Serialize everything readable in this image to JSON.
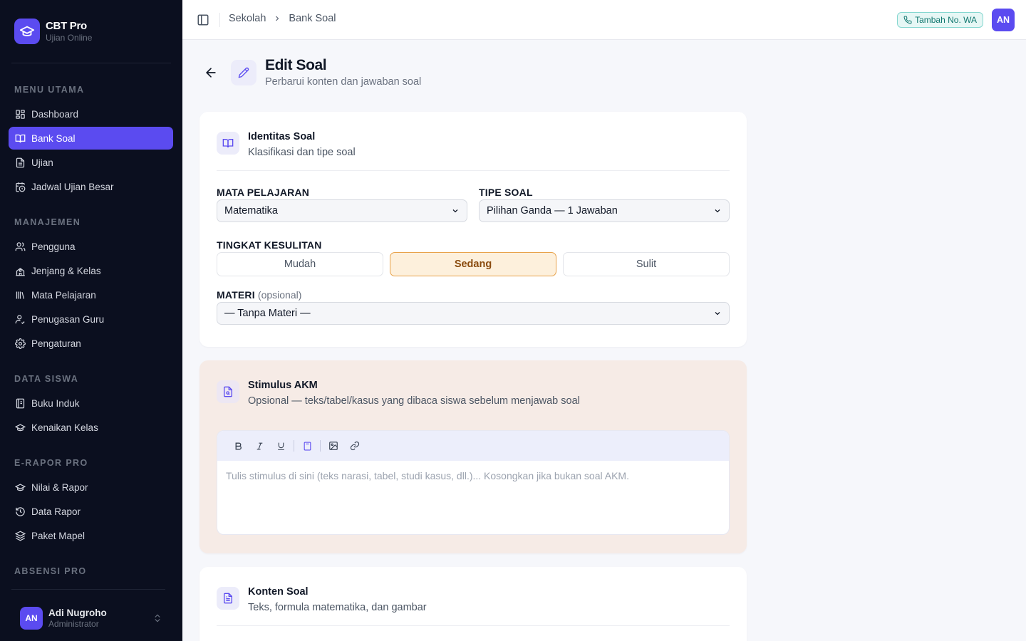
{
  "brand": {
    "name": "CBT Pro",
    "subtitle": "Ujian Online"
  },
  "sidebar": {
    "sections": [
      {
        "title": "MENU UTAMA",
        "items": [
          {
            "label": "Dashboard",
            "icon": "dashboard-icon",
            "active": false
          },
          {
            "label": "Bank Soal",
            "icon": "book-icon",
            "active": true
          },
          {
            "label": "Ujian",
            "icon": "file-icon",
            "active": false
          },
          {
            "label": "Jadwal Ujian Besar",
            "icon": "calendar-clock-icon",
            "active": false
          }
        ]
      },
      {
        "title": "MANAJEMEN",
        "items": [
          {
            "label": "Pengguna",
            "icon": "users-icon",
            "active": false
          },
          {
            "label": "Jenjang & Kelas",
            "icon": "school-icon",
            "active": false
          },
          {
            "label": "Mata Pelajaran",
            "icon": "library-icon",
            "active": false
          },
          {
            "label": "Penugasan Guru",
            "icon": "user-assign-icon",
            "active": false
          },
          {
            "label": "Pengaturan",
            "icon": "gear-icon",
            "active": false
          }
        ]
      },
      {
        "title": "DATA SISWA",
        "items": [
          {
            "label": "Buku Induk",
            "icon": "notebook-icon",
            "active": false
          },
          {
            "label": "Kenaikan Kelas",
            "icon": "graduation-icon",
            "active": false
          }
        ]
      },
      {
        "title": "E-RAPOR PRO",
        "items": [
          {
            "label": "Nilai & Rapor",
            "icon": "graduation-icon",
            "active": false
          },
          {
            "label": "Data Rapor",
            "icon": "history-icon",
            "active": false
          },
          {
            "label": "Paket Mapel",
            "icon": "layers-icon",
            "active": false
          }
        ]
      },
      {
        "title": "ABSENSI PRO",
        "items": []
      }
    ]
  },
  "user": {
    "initials": "AN",
    "name": "Adi Nugroho",
    "role": "Administrator"
  },
  "topbar": {
    "breadcrumb": [
      "Sekolah",
      "Bank Soal"
    ],
    "wa_button": "Tambah No. WA",
    "avatar_initials": "AN"
  },
  "page": {
    "title": "Edit Soal",
    "subtitle": "Perbarui konten dan jawaban soal"
  },
  "identitas": {
    "title": "Identitas Soal",
    "subtitle": "Klasifikasi dan tipe soal",
    "mapel_label": "MATA PELAJARAN",
    "mapel_value": "Matematika",
    "tipe_label": "TIPE SOAL",
    "tipe_value": "Pilihan Ganda — 1 Jawaban",
    "kesulitan_label": "TINGKAT KESULITAN",
    "kesulitan_options": [
      "Mudah",
      "Sedang",
      "Sulit"
    ],
    "kesulitan_selected": "Sedang",
    "materi_label": "MATERI",
    "materi_optional": "(opsional)",
    "materi_value": "— Tanpa Materi —"
  },
  "stimulus": {
    "title": "Stimulus AKM",
    "subtitle": "Opsional — teks/tabel/kasus yang dibaca siswa sebelum menjawab soal",
    "placeholder": "Tulis stimulus di sini (teks narasi, tabel, studi kasus, dll.)... Kosongkan jika bukan soal AKM."
  },
  "konten": {
    "title": "Konten Soal",
    "subtitle": "Teks, formula matematika, dan gambar"
  },
  "colors": {
    "accent": "#5b4bf0",
    "sidebar_bg": "#0b0f1f",
    "stimulus_bg": "#f6ebe6",
    "selected_bg": "#fdf0dc",
    "selected_border": "#e8a24a"
  }
}
